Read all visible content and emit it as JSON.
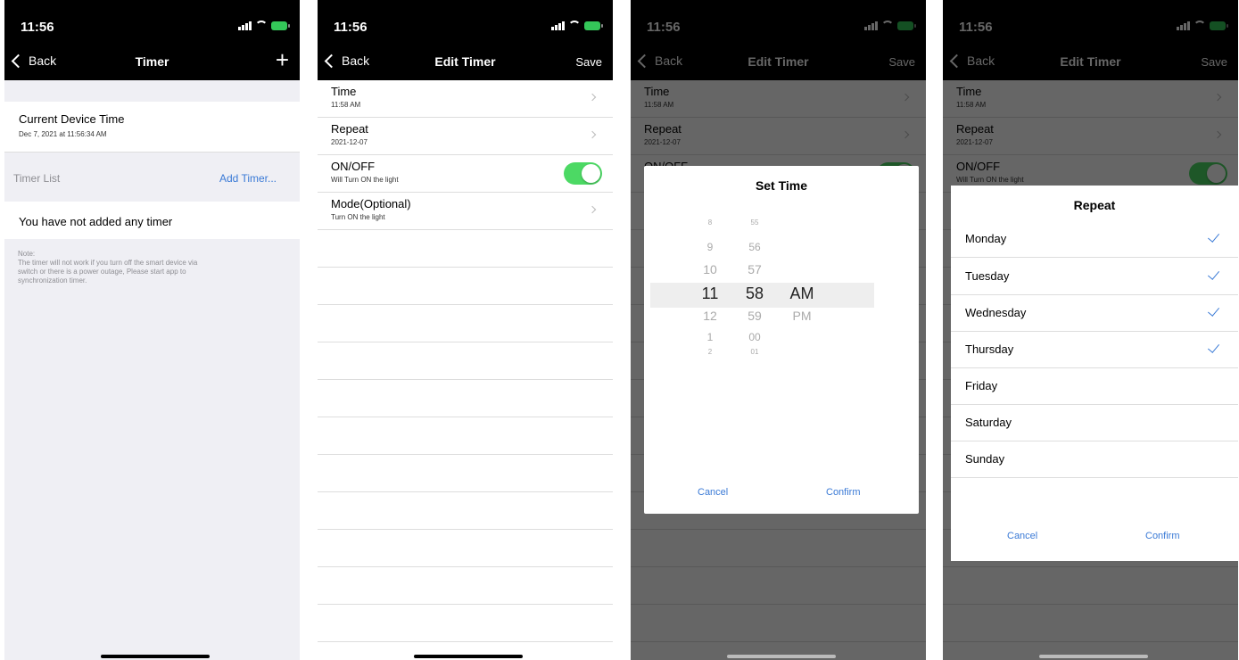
{
  "status": {
    "time": "11:56"
  },
  "screen1": {
    "nav": {
      "back_label": "Back",
      "title": "Timer",
      "add_label": "+"
    },
    "current_device_time": {
      "label": "Current Device Time",
      "value": "Dec 7, 2021 at 11:56:34 AM"
    },
    "timer_list": {
      "label": "Timer List",
      "add_label": "Add Timer..."
    },
    "empty_message": "You have not added any timer",
    "note": {
      "title": "Note:",
      "lines": [
        "The timer will not work if you turn off the smart device via",
        "switch or there is a power outage, Please start app to",
        "synchronization timer."
      ]
    }
  },
  "screen2": {
    "nav": {
      "back_label": "Back",
      "title": "Edit Timer",
      "save_label": "Save"
    },
    "rows": [
      {
        "title": "Time",
        "subtitle": "11:58 AM"
      },
      {
        "title": "Repeat",
        "subtitle": "2021-12-07"
      },
      {
        "title": "ON/OFF",
        "subtitle": "Will Turn ON the light",
        "toggle_on": true
      },
      {
        "title": "Mode(Optional)",
        "subtitle": "Turn ON the light"
      }
    ]
  },
  "screen3": {
    "dialog": {
      "title": "Set Time",
      "hours": [
        "8",
        "9",
        "10",
        "11",
        "12",
        "1",
        "2"
      ],
      "minutes": [
        "55",
        "56",
        "57",
        "58",
        "59",
        "00",
        "01"
      ],
      "periods": [
        "AM",
        "PM"
      ],
      "selected": {
        "hour": "11",
        "minute": "58",
        "period": "AM"
      },
      "cancel_label": "Cancel",
      "confirm_label": "Confirm"
    }
  },
  "screen4": {
    "dialog": {
      "title": "Repeat",
      "days": [
        {
          "name": "Monday",
          "checked": true
        },
        {
          "name": "Tuesday",
          "checked": true
        },
        {
          "name": "Wednesday",
          "checked": true
        },
        {
          "name": "Thursday",
          "checked": true
        },
        {
          "name": "Friday",
          "checked": false
        },
        {
          "name": "Saturday",
          "checked": false
        },
        {
          "name": "Sunday",
          "checked": false
        }
      ],
      "cancel_label": "Cancel",
      "confirm_label": "Confirm"
    }
  },
  "colors": {
    "accent": "#3a7ad6",
    "toggle_on": "#4cd964",
    "group_bg": "#efeff4",
    "check": "#3a7ad6"
  }
}
